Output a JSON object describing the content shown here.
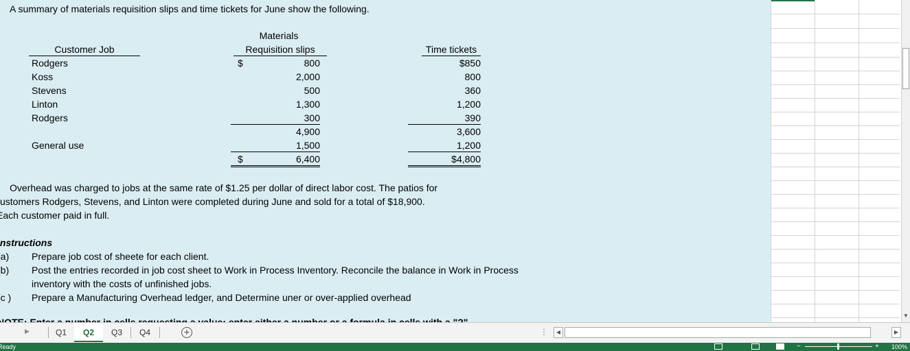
{
  "intro": "A summary of materials requisition slips and time tickets for June show the following.",
  "table": {
    "header_customer": "Customer Job",
    "header_materials_line1": "Materials",
    "header_materials_line2": "Requisition slips",
    "header_time": "Time tickets",
    "rows": [
      {
        "job": "Rodgers",
        "materials": "800",
        "time": "$850",
        "mat_dollar": "$"
      },
      {
        "job": "Koss",
        "materials": "2,000",
        "time": "800"
      },
      {
        "job": "Stevens",
        "materials": "500",
        "time": "360"
      },
      {
        "job": "Linton",
        "materials": "1,300",
        "time": "1,200"
      },
      {
        "job": "Rodgers",
        "materials": "300",
        "time": "390"
      }
    ],
    "subtotal": {
      "materials": "4,900",
      "time": "3,600"
    },
    "general": {
      "job": "General use",
      "materials": "1,500",
      "time": "1,200"
    },
    "total": {
      "dollar": "$",
      "materials": "6,400",
      "time": "$4,800"
    }
  },
  "overhead": {
    "line1": "Overhead was charged to jobs at the same rate of $1.25 per dollar of direct labor cost.  The patios for",
    "line2": "customers Rodgers, Stevens, and Linton were completed during June and sold for a total of $18,900.",
    "line3": "Each customer paid in full."
  },
  "instructions": {
    "heading": "Instructions",
    "items": [
      {
        "label": "(a)",
        "text": "Prepare job cost of sheete for each client."
      },
      {
        "label": "(b)",
        "text": "Post the entries recorded in job cost sheet to Work in Process Inventory. Reconcile the balance in Work in Process",
        "text2": "inventory with the costs of unfinished jobs."
      },
      {
        "label": "(c )",
        "text": "Prepare a Manufacturing Overhead ledger, and  Determine uner or over-applied overhead"
      }
    ],
    "cut_line": "NOTE: Enter a number in cells requesting a value; enter either a number or a formula in cells with a \"?\""
  },
  "tabs": [
    "Q1",
    "Q2",
    "Q3",
    "Q4"
  ],
  "active_tab": "Q2",
  "add_sheet_icon": "plus-circle-icon",
  "status": {
    "left": "Ready",
    "zoom": "100%"
  }
}
